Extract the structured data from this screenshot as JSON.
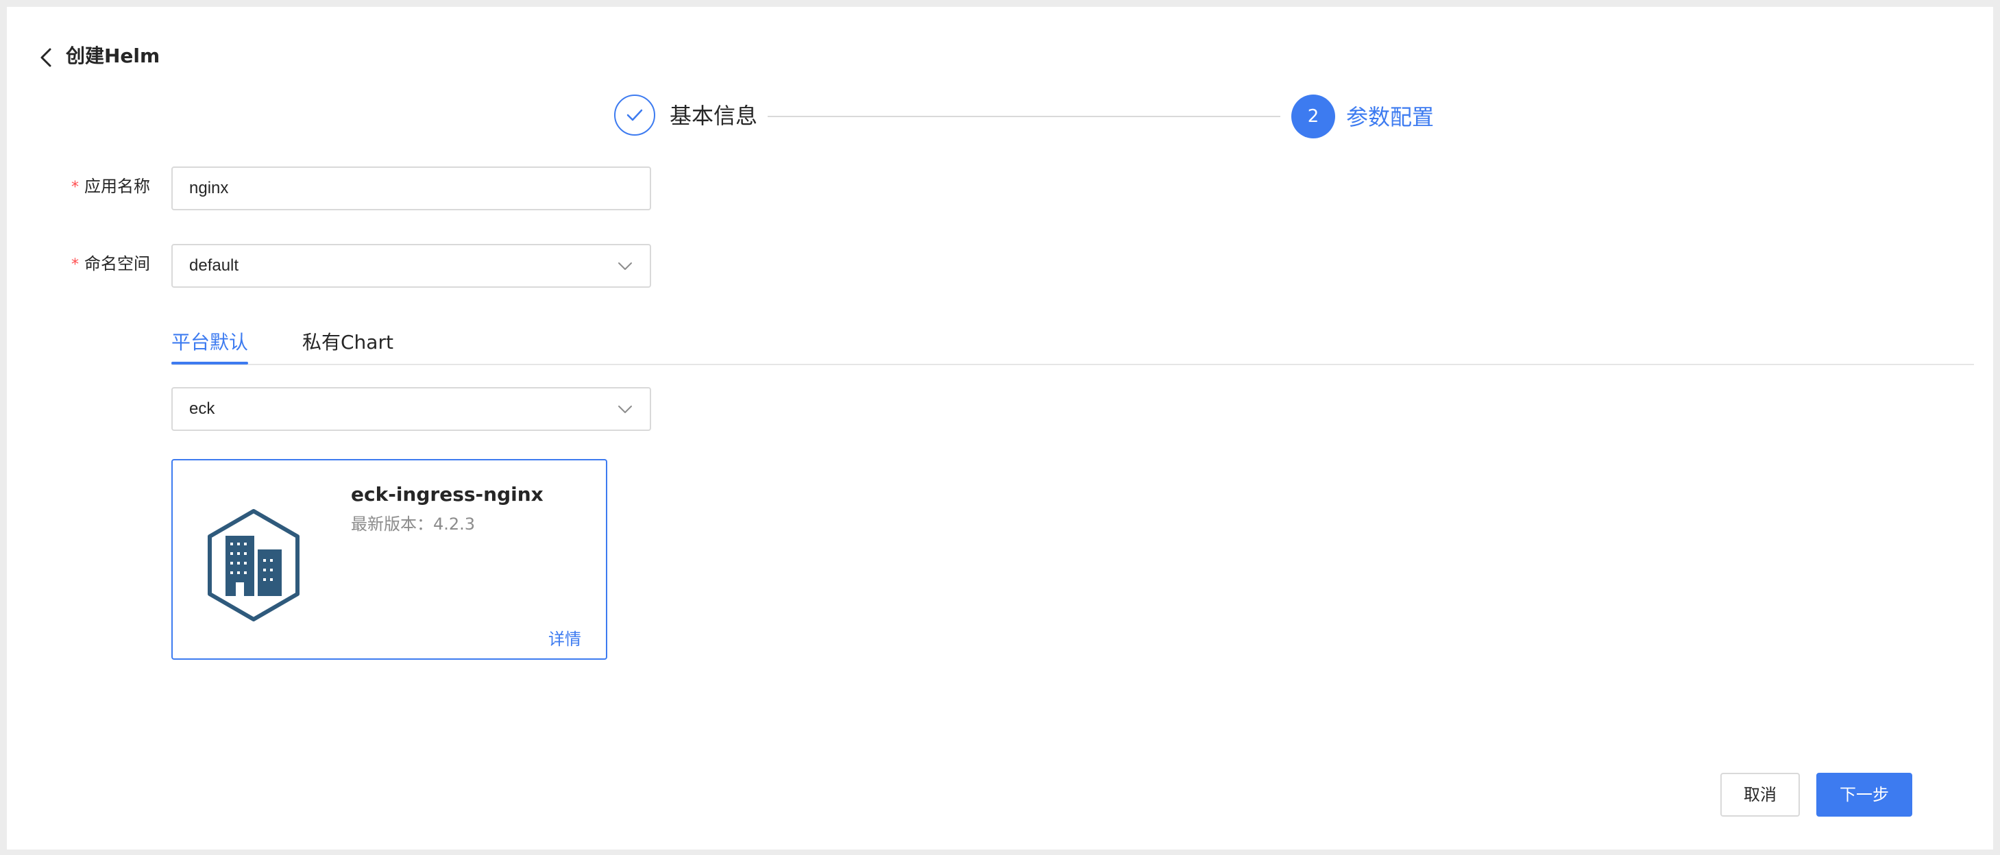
{
  "header": {
    "title": "创建Helm"
  },
  "steps": [
    {
      "label": "基本信息",
      "status": "done"
    },
    {
      "label": "参数配置",
      "number": "2",
      "status": "active"
    }
  ],
  "form": {
    "app_name": {
      "label": "应用名称",
      "required_mark": "*",
      "value": "nginx"
    },
    "namespace": {
      "label": "命名空间",
      "required_mark": "*",
      "value": "default"
    }
  },
  "tabs": [
    {
      "label": "平台默认",
      "active": true
    },
    {
      "label": "私有Chart",
      "active": false
    }
  ],
  "chart_select": {
    "value": "eck"
  },
  "chart_card": {
    "name": "eck-ingress-nginx",
    "version_text": "最新版本：4.2.3",
    "detail_link": "详情",
    "icon": "building-icon"
  },
  "footer": {
    "cancel_label": "取消",
    "next_label": "下一步"
  },
  "colors": {
    "primary": "#3d7bf0",
    "required": "#ff4d4f",
    "icon_dark": "#2f5a7c"
  }
}
